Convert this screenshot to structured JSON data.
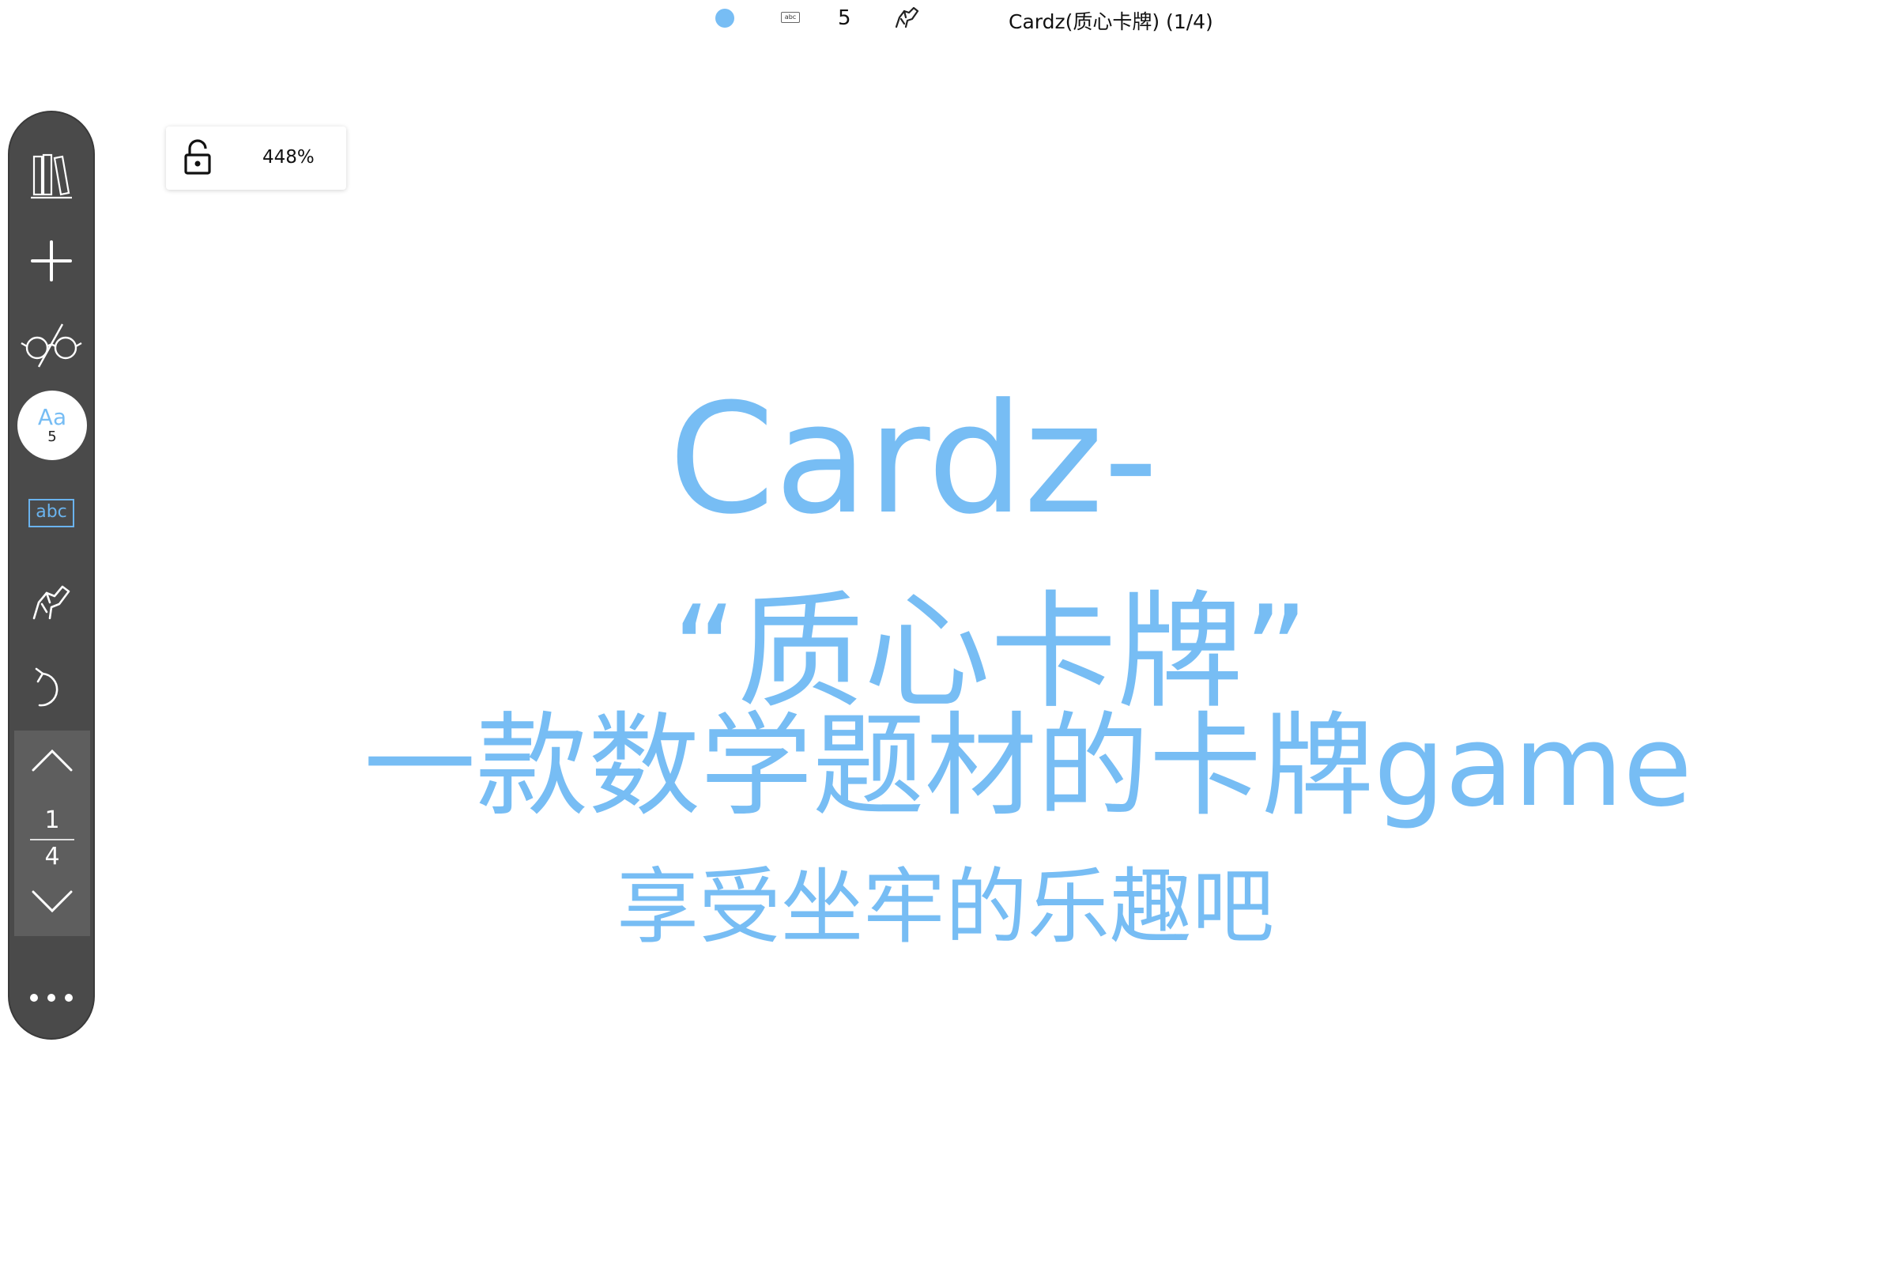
{
  "topbar": {
    "mode_dot_color": "#77bdf4",
    "text_tool_label": "abc",
    "font_size_value": "5",
    "pen_icon": "hand-pen-icon",
    "document_title": "Cardz(质心卡牌) (1/4)"
  },
  "sidebar": {
    "items": [
      {
        "name": "library",
        "icon": "library-books-icon"
      },
      {
        "name": "add",
        "icon": "plus-icon"
      },
      {
        "name": "read-mode",
        "icon": "glasses-icon"
      },
      {
        "name": "font",
        "label": "Aa",
        "size": "5"
      },
      {
        "name": "text-box",
        "label": "abc"
      },
      {
        "name": "pen",
        "icon": "hand-pen-icon"
      },
      {
        "name": "undo",
        "icon": "undo-icon"
      },
      {
        "name": "more",
        "icon": "more-dots-icon"
      }
    ],
    "pager": {
      "current": "1",
      "total": "4"
    }
  },
  "zoom": {
    "lock_icon": "unlock-icon",
    "percent": "448%"
  },
  "slide": {
    "line1": "Cardz-",
    "line2": "“质心卡牌”",
    "line3": "一款数学题材的卡牌game",
    "line4": "享受坐牢的乐趣吧"
  },
  "colors": {
    "accent": "#77bdf4",
    "sidebar": "#4a4a4a"
  }
}
